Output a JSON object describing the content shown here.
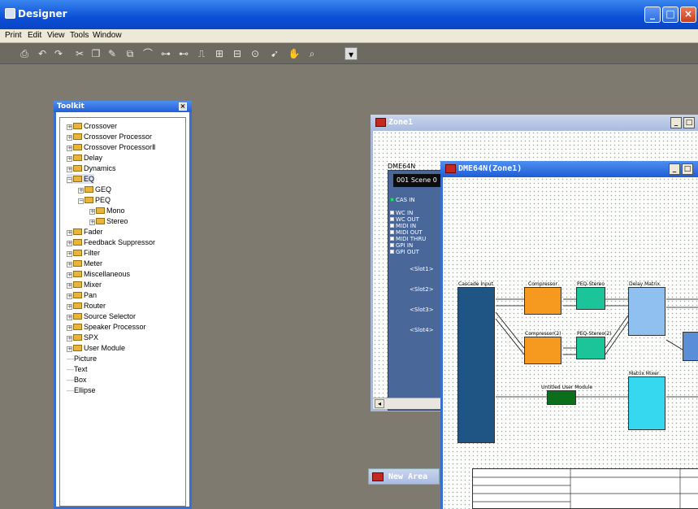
{
  "app": {
    "title": "Designer"
  },
  "menu": [
    "Print",
    "Edit",
    "View",
    "Tools",
    "Window"
  ],
  "toolbar_icons": [
    "print-icon",
    "undo-icon",
    "redo-icon",
    "cut-icon",
    "copy-icon",
    "paste-icon",
    "clone-icon",
    "arc-icon",
    "wire-icon",
    "link-icon",
    "bus-icon",
    "align-icon",
    "distribute-icon",
    "zoom-icon",
    "pointer-icon",
    "hand-icon",
    "magnify-icon",
    "dropdown-icon"
  ],
  "toolkit": {
    "title": "Toolkit",
    "items": [
      {
        "label": "Crossover",
        "level": 0,
        "type": "folder"
      },
      {
        "label": "Crossover Processor",
        "level": 0,
        "type": "folder"
      },
      {
        "label": "Crossover ProcessorⅡ",
        "level": 0,
        "type": "folder"
      },
      {
        "label": "Delay",
        "level": 0,
        "type": "folder"
      },
      {
        "label": "Dynamics",
        "level": 0,
        "type": "folder"
      },
      {
        "label": "EQ",
        "level": 0,
        "type": "folder",
        "selected": true
      },
      {
        "label": "GEQ",
        "level": 1,
        "type": "folder"
      },
      {
        "label": "PEQ",
        "level": 1,
        "type": "folder"
      },
      {
        "label": "Mono",
        "level": 2,
        "type": "folder"
      },
      {
        "label": "Stereo",
        "level": 2,
        "type": "folder"
      },
      {
        "label": "Fader",
        "level": 0,
        "type": "folder"
      },
      {
        "label": "Feedback Suppressor",
        "level": 0,
        "type": "folder"
      },
      {
        "label": "Filter",
        "level": 0,
        "type": "folder"
      },
      {
        "label": "Meter",
        "level": 0,
        "type": "folder"
      },
      {
        "label": "Miscellaneous",
        "level": 0,
        "type": "folder"
      },
      {
        "label": "Mixer",
        "level": 0,
        "type": "folder"
      },
      {
        "label": "Pan",
        "level": 0,
        "type": "folder"
      },
      {
        "label": "Router",
        "level": 0,
        "type": "folder"
      },
      {
        "label": "Source Selector",
        "level": 0,
        "type": "folder"
      },
      {
        "label": "Speaker Processor",
        "level": 0,
        "type": "folder"
      },
      {
        "label": "SPX",
        "level": 0,
        "type": "folder"
      },
      {
        "label": "User Module",
        "level": 0,
        "type": "folder"
      },
      {
        "label": "Picture",
        "level": 0,
        "type": "leaf"
      },
      {
        "label": "Text",
        "level": 0,
        "type": "leaf"
      },
      {
        "label": "Box",
        "level": 0,
        "type": "leaf"
      },
      {
        "label": "Ellipse",
        "level": 0,
        "type": "leaf"
      }
    ]
  },
  "zone": {
    "title": "Zone1",
    "device_label": "DME64N",
    "scene": "001 Scene 0",
    "cas_in": "CAS IN",
    "ports": [
      "WC IN",
      "WC OUT",
      "MIDI IN",
      "MIDI OUT",
      "MIDI THRU",
      "GPI IN",
      "GPI OUT"
    ],
    "slots": [
      "<Slot1>",
      "<Slot2>",
      "<Slot3>",
      "<Slot4>"
    ]
  },
  "dme": {
    "title": "DME64N(Zone1)",
    "blocks": {
      "cascade": "Cascade Input",
      "compressor1": "Compressor",
      "compressor2": "Compressor(2)",
      "peq1": "PEQ-Stereo",
      "peq2": "PEQ-Stereo(2)",
      "matrix": "Delay Matrix",
      "mixer": "Matrix Mixer",
      "user": "Untitled User Module"
    }
  },
  "new_area": {
    "title": "New Area"
  }
}
